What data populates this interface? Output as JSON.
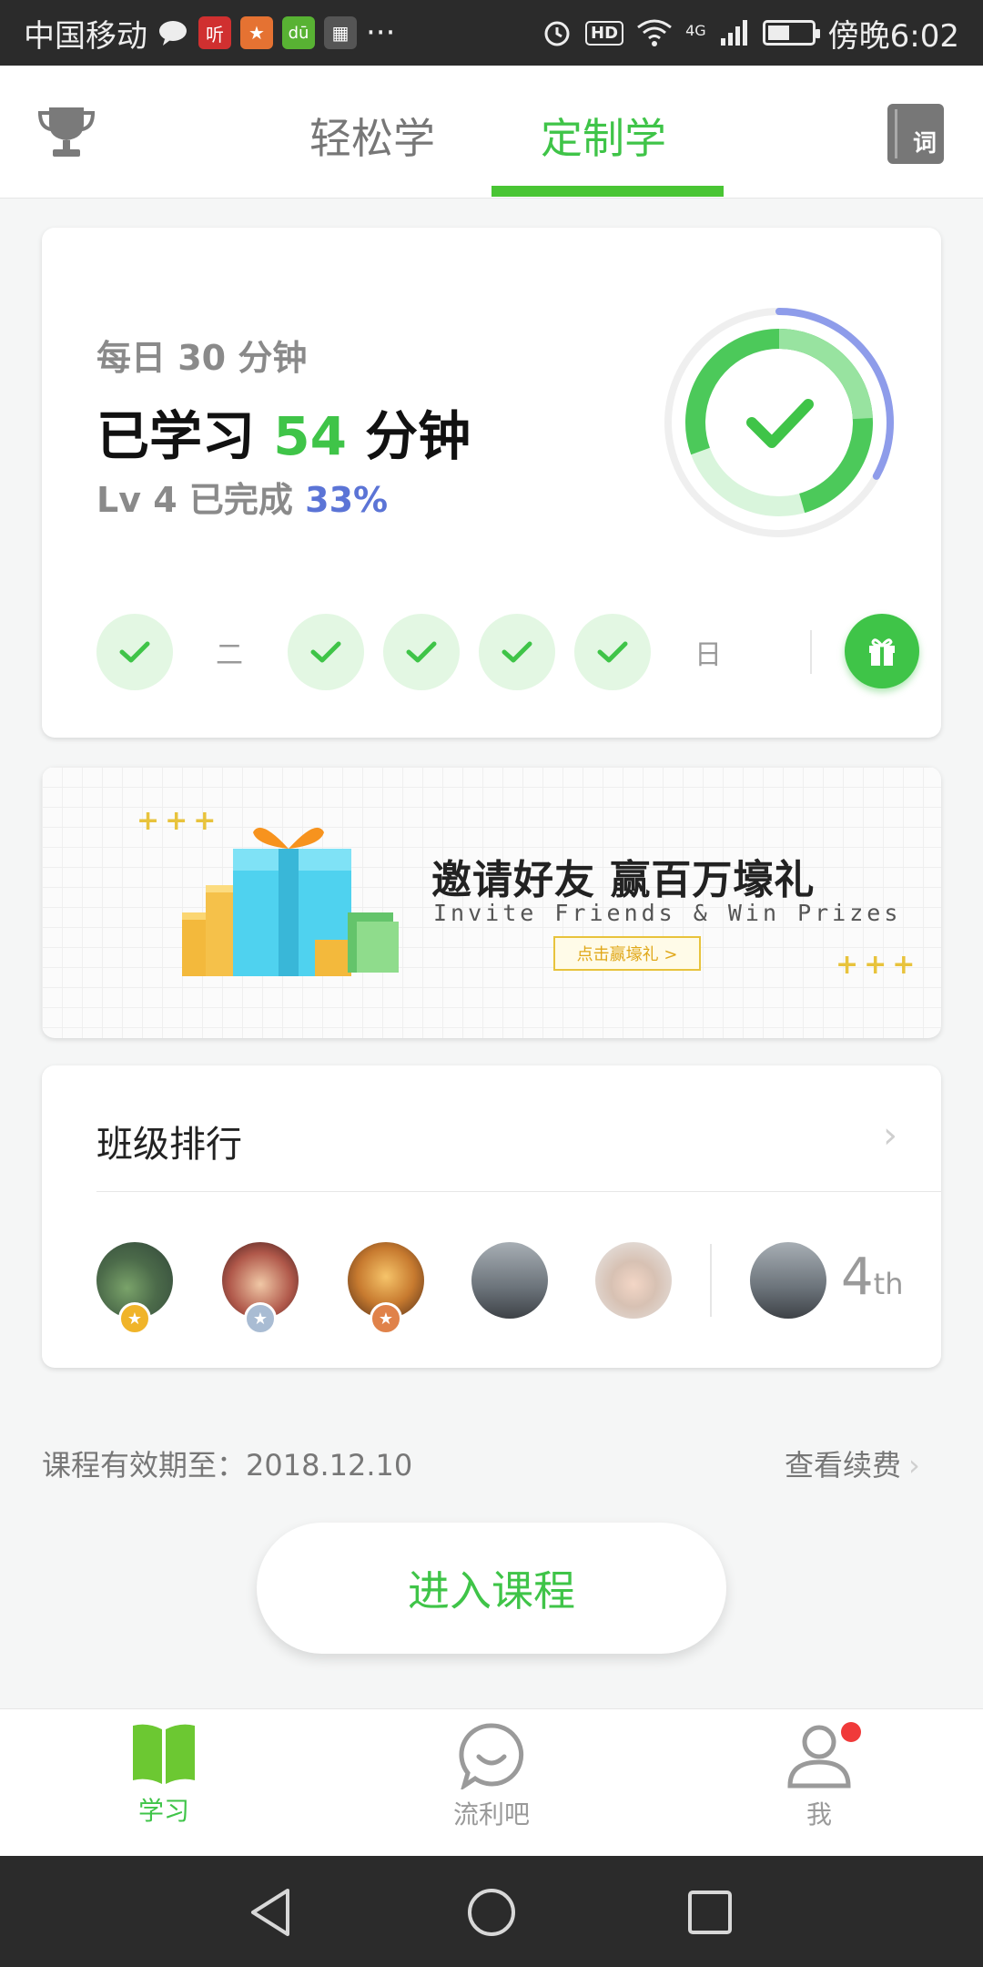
{
  "status_bar": {
    "carrier": "中国移动",
    "app_icons": [
      "message-icon",
      "ting-icon",
      "sport-icon",
      "du-icon",
      "gallery-icon"
    ],
    "more": "···",
    "hd": "HD",
    "network": "4G",
    "time_label": "傍晚6:02"
  },
  "header": {
    "trophy_icon": "trophy-icon",
    "tabs": [
      {
        "label": "轻松学",
        "active": false
      },
      {
        "label": "定制学",
        "active": true
      }
    ],
    "dict_label": "词"
  },
  "progress_card": {
    "daily_goal": "每日 30 分钟",
    "learned_prefix": "已学习",
    "learned_minutes": "54",
    "learned_suffix": "分钟",
    "level_prefix": "Lv 4 已完成",
    "level_percent": "33%",
    "ring_fraction": 0.33,
    "days": [
      {
        "label": "",
        "done": true
      },
      {
        "label": "二",
        "done": false
      },
      {
        "label": "",
        "done": true
      },
      {
        "label": "",
        "done": true
      },
      {
        "label": "",
        "done": true
      },
      {
        "label": "",
        "done": true
      },
      {
        "label": "日",
        "done": false
      }
    ],
    "reward_icon": "gift-icon"
  },
  "banner": {
    "title": "邀请好友 赢百万壕礼",
    "subtitle": "Invite Friends & Win Prizes",
    "button": "点击赢壕礼 >"
  },
  "ranking": {
    "title": "班级排行",
    "chevron": "›",
    "medals": [
      "gold",
      "silver",
      "bronze"
    ],
    "my_rank": "4",
    "my_rank_suffix": "th"
  },
  "course": {
    "expiry_label": "课程有效期至：2018.12.10",
    "renew_label": "查看续费",
    "renew_chevron": "›",
    "enter_label": "进入课程"
  },
  "bottom_nav": [
    {
      "label": "学习",
      "icon": "book-icon",
      "active": true
    },
    {
      "label": "流利吧",
      "icon": "chat-smile-icon",
      "active": false
    },
    {
      "label": "我",
      "icon": "person-icon",
      "active": false,
      "badge": true
    }
  ],
  "colors": {
    "accent_green": "#3fc448",
    "level_blue": "#5b74d6",
    "badge_red": "#f03a3a"
  }
}
